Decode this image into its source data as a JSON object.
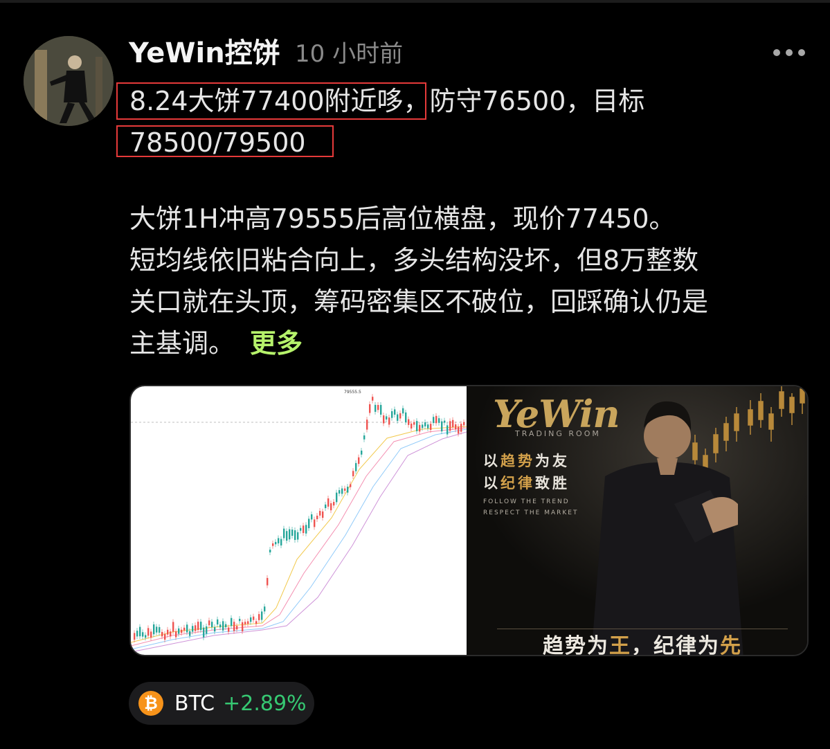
{
  "post": {
    "author": "YeWin控饼",
    "time": "10 小时前",
    "line1_hl": "8.24大饼77400附近哆",
    "line1_rest": "，防守76500，目标",
    "line2_hl": "78500/79500",
    "para_lines": [
      "大饼1H冲高79555后高位横盘，现价77450。",
      "短均线依旧粘合向上，多头结构没坏，但8万整数",
      "关口就在头顶，筹码密集区不破位，回踩确认仍是"
    ],
    "last_line": "主基调。",
    "more_label": "更多"
  },
  "media": {
    "chart_peak_label": "79555.5",
    "promo": {
      "logo": "YeWin",
      "subtitle": "TRADING ROOM",
      "cn_line1_pre": "以",
      "cn_line1_hl": "趋势",
      "cn_line1_post": "为友",
      "cn_line2_pre": "以",
      "cn_line2_hl": "纪律",
      "cn_line2_post": "致胜",
      "en_line1": "FOLLOW THE TREND",
      "en_line2": "RESPECT THE MARKET",
      "bottom_a": "趋势为",
      "bottom_b": "王",
      "bottom_c": "，纪律为",
      "bottom_d": "先"
    }
  },
  "ticker": {
    "symbol": "BTC",
    "icon_glyph": "₿",
    "change": "+2.89%",
    "change_color": "#36c872",
    "icon_color": "#f7931a"
  },
  "colors": {
    "highlight_box": "#e63a3a",
    "more_link": "#b6f26b"
  }
}
